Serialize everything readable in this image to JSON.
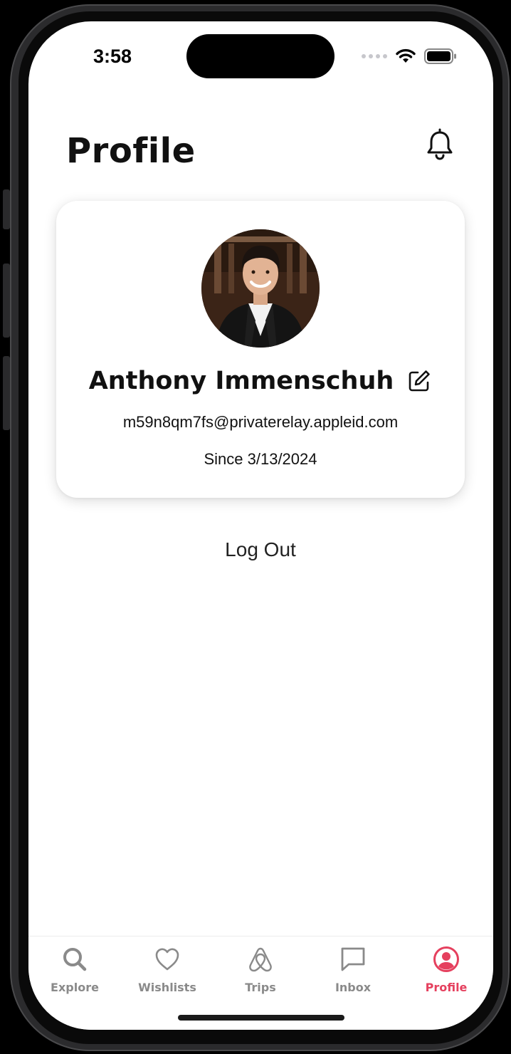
{
  "status_bar": {
    "time": "3:58"
  },
  "header": {
    "title": "Profile"
  },
  "profile": {
    "name": "Anthony Immenschuh",
    "email": "m59n8qm7fs@privaterelay.appleid.com",
    "member_since": "Since 3/13/2024"
  },
  "actions": {
    "logout_label": "Log Out"
  },
  "tabs": [
    {
      "label": "Explore",
      "icon": "search-icon",
      "active": false
    },
    {
      "label": "Wishlists",
      "icon": "heart-icon",
      "active": false
    },
    {
      "label": "Trips",
      "icon": "airbnb-logo-icon",
      "active": false
    },
    {
      "label": "Inbox",
      "icon": "message-icon",
      "active": false
    },
    {
      "label": "Profile",
      "icon": "user-circle-icon",
      "active": true
    }
  ],
  "colors": {
    "accent": "#e5405e",
    "inactive": "#8a8a8a",
    "text": "#111111"
  }
}
